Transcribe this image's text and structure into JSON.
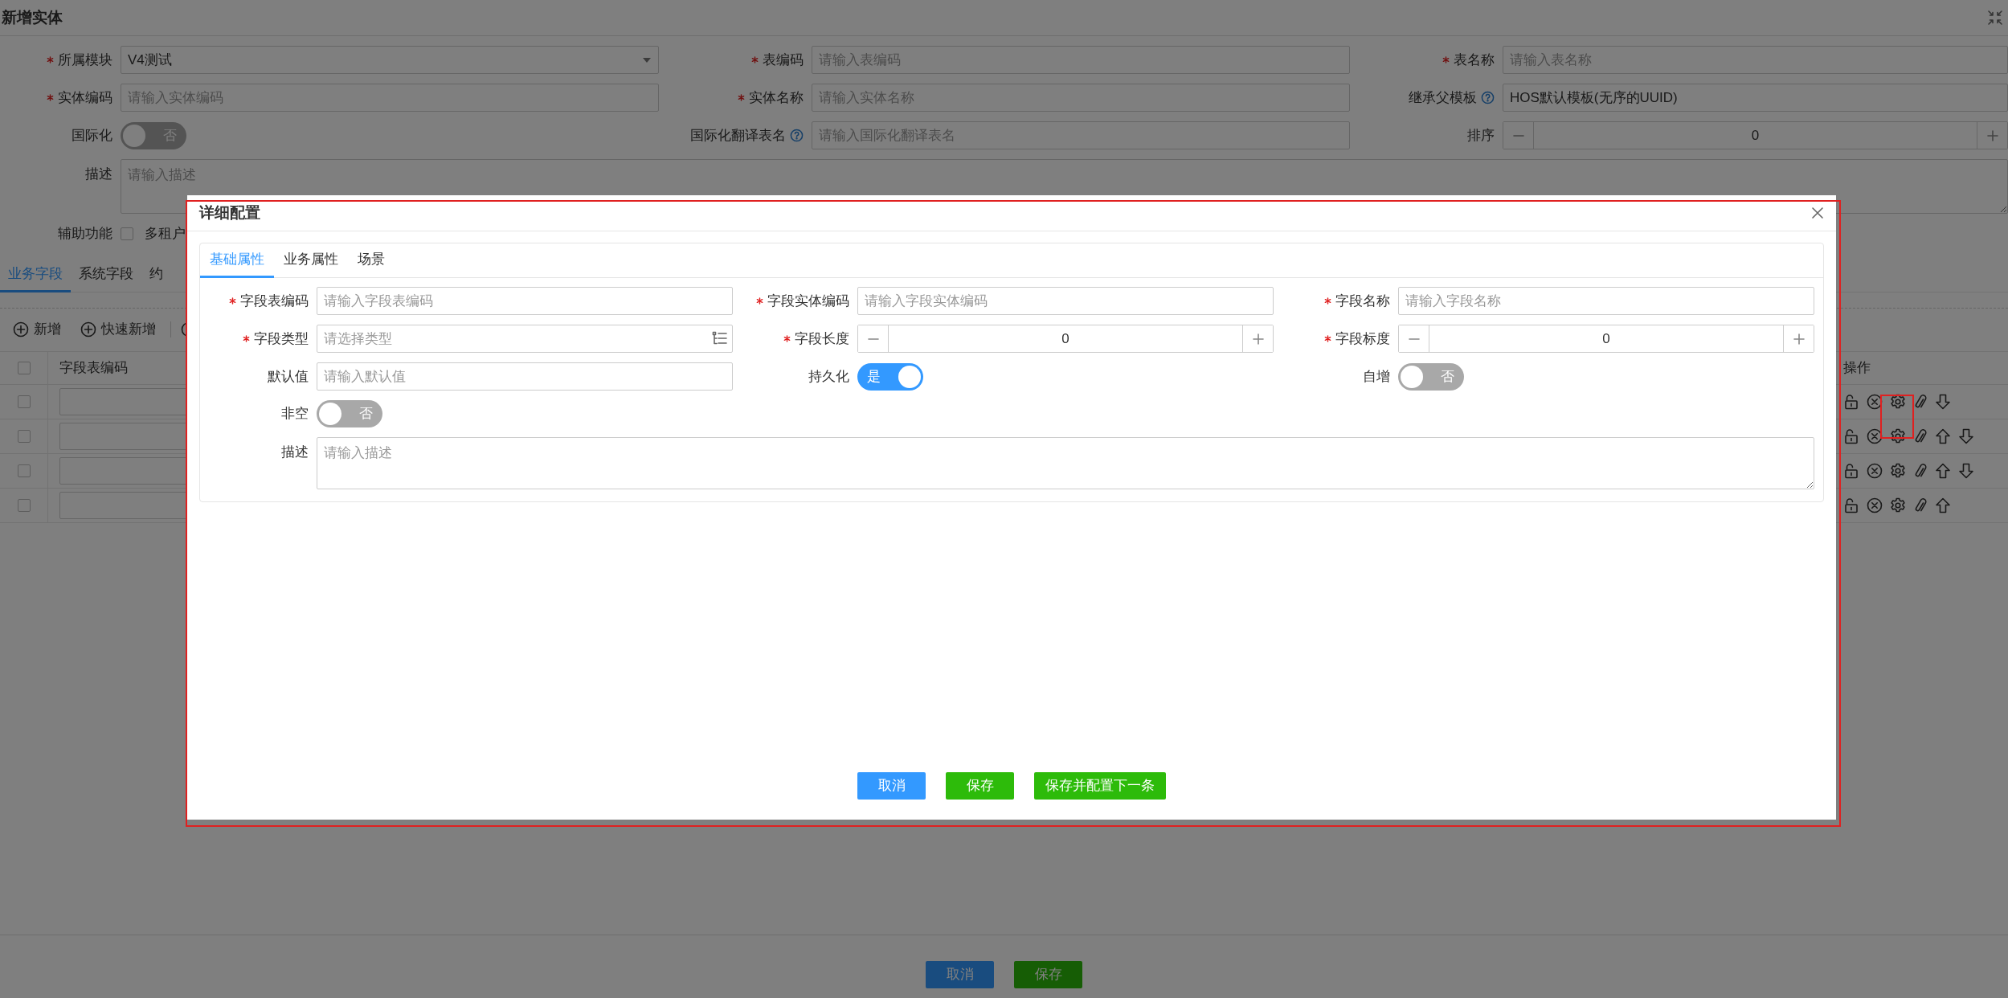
{
  "page": {
    "title": "新增实体"
  },
  "entity_form": [
    {
      "kind": "select",
      "label": "所属模块",
      "required": true,
      "help": false,
      "value": "V4测试"
    },
    {
      "kind": "text",
      "label": "表编码",
      "required": true,
      "help": false,
      "placeholder": "请输入表编码"
    },
    {
      "kind": "text",
      "label": "表名称",
      "required": true,
      "help": false,
      "placeholder": "请输入表名称"
    },
    {
      "kind": "text",
      "label": "实体编码",
      "required": true,
      "help": false,
      "placeholder": "请输入实体编码"
    },
    {
      "kind": "text",
      "label": "实体名称",
      "required": true,
      "help": false,
      "placeholder": "请输入实体名称"
    },
    {
      "kind": "text",
      "label": "继承父模板",
      "required": false,
      "help": true,
      "value": "HOS默认模板(无序的UUID)"
    },
    {
      "kind": "switch",
      "label": "国际化",
      "required": false,
      "help": false,
      "on": false,
      "text": "否"
    },
    {
      "kind": "text",
      "label": "国际化翻译表名",
      "required": false,
      "help": true,
      "placeholder": "请输入国际化翻译表名"
    },
    {
      "kind": "stepper",
      "label": "排序",
      "required": false,
      "help": false,
      "value": "0"
    },
    {
      "kind": "textarea",
      "label": "描述",
      "required": false,
      "help": false,
      "placeholder": "请输入描述"
    },
    {
      "kind": "checkbox",
      "label": "辅助功能",
      "required": false,
      "help": false,
      "checked": false,
      "text": "多租户"
    }
  ],
  "field_tabs": [
    {
      "label": "业务字段",
      "selected": true
    },
    {
      "label": "系统字段",
      "selected": false
    },
    {
      "label": "约",
      "selected": false
    }
  ],
  "toolbar": [
    {
      "label": "新增"
    },
    {
      "label": "快速新增"
    }
  ],
  "table": {
    "columns": [
      "字段表编码",
      "操作"
    ],
    "header_checked": false,
    "rows": [
      {
        "checked": false,
        "move_up": false,
        "move_down": true
      },
      {
        "checked": false,
        "move_up": true,
        "move_down": true
      },
      {
        "checked": false,
        "move_up": true,
        "move_down": true
      },
      {
        "checked": false,
        "move_up": true,
        "move_down": false
      }
    ]
  },
  "footer_buttons": [
    {
      "label": "取消",
      "kind": "primary"
    },
    {
      "label": "保存",
      "kind": "success"
    }
  ],
  "dialog": {
    "title": "详细配置",
    "tabs": [
      {
        "label": "基础属性",
        "selected": true
      },
      {
        "label": "业务属性",
        "selected": false
      },
      {
        "label": "场景",
        "selected": false
      }
    ],
    "fields": [
      {
        "kind": "text",
        "label": "字段表编码",
        "required": true,
        "help": false,
        "placeholder": "请输入字段表编码"
      },
      {
        "kind": "text",
        "label": "字段实体编码",
        "required": true,
        "help": false,
        "placeholder": "请输入字段实体编码"
      },
      {
        "kind": "text",
        "label": "字段名称",
        "required": true,
        "help": false,
        "placeholder": "请输入字段名称"
      },
      {
        "kind": "picker",
        "label": "字段类型",
        "required": true,
        "help": false,
        "placeholder": "请选择类型"
      },
      {
        "kind": "stepper",
        "label": "字段长度",
        "required": true,
        "help": false,
        "value": "0"
      },
      {
        "kind": "stepper",
        "label": "字段标度",
        "required": true,
        "help": false,
        "value": "0"
      },
      {
        "kind": "text",
        "label": "默认值",
        "required": false,
        "help": false,
        "placeholder": "请输入默认值"
      },
      {
        "kind": "switch",
        "label": "持久化",
        "required": false,
        "help": false,
        "on": true,
        "text": "是"
      },
      {
        "kind": "switch",
        "label": "自增",
        "required": false,
        "help": false,
        "on": false,
        "text": "否"
      },
      {
        "kind": "switch",
        "label": "非空",
        "required": false,
        "help": false,
        "on": false,
        "text": "否"
      },
      {
        "kind": "textarea",
        "label": "描述",
        "required": false,
        "help": false,
        "placeholder": "请输入描述"
      }
    ],
    "buttons": [
      {
        "label": "取消",
        "kind": "primary"
      },
      {
        "label": "保存",
        "kind": "success"
      },
      {
        "label": "保存并配置下一条",
        "kind": "success"
      }
    ]
  }
}
